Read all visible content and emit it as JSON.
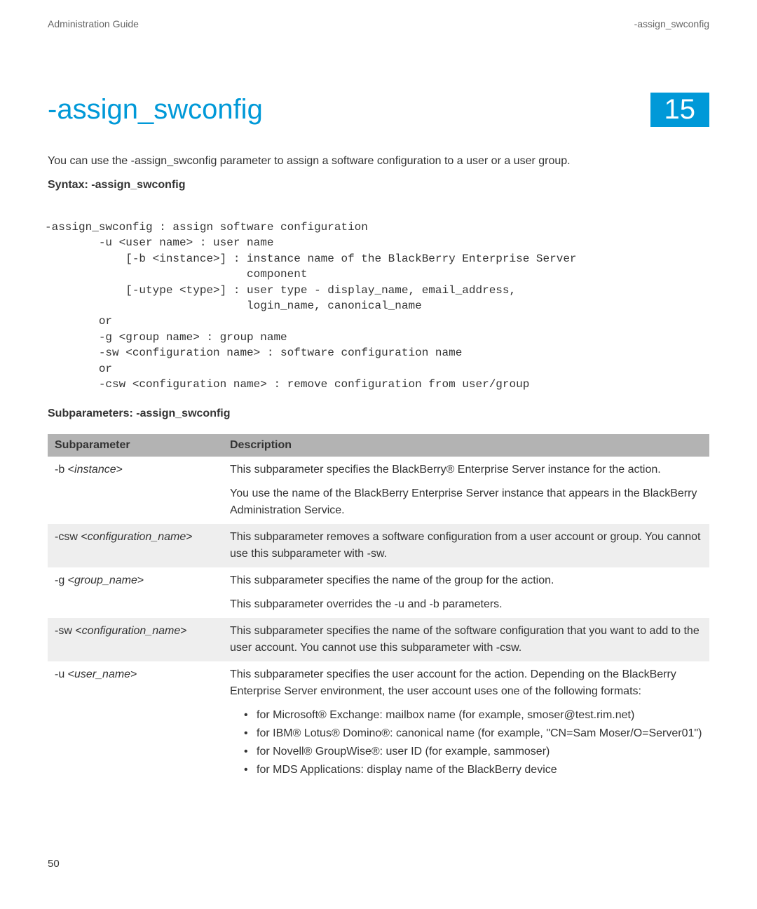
{
  "header": {
    "left": "Administration Guide",
    "right": "-assign_swconfig"
  },
  "title": "-assign_swconfig",
  "chapter": "15",
  "intro": "You can use the -assign_swconfig parameter to assign a software configuration to a user or a user group.",
  "syntax_label_prefix": "Syntax: ",
  "syntax_label_bold": "-assign_swconfig",
  "code": "-assign_swconfig : assign software configuration\n        -u <user name> : user name\n            [-b <instance>] : instance name of the BlackBerry Enterprise Server\n                              component\n            [-utype <type>] : user type - display_name, email_address,\n                              login_name, canonical_name\n        or\n        -g <group name> : group name\n        -sw <configuration name> : software configuration name\n        or\n        -csw <configuration name> : remove configuration from user/group",
  "subparam_label_prefix": "Subparameters: ",
  "subparam_label_bold": "-assign_swconfig",
  "table": {
    "headers": {
      "col1": "Subparameter",
      "col2": "Description"
    },
    "rows": [
      {
        "param_prefix": "-b <",
        "param_italic": "instance",
        "param_suffix": ">",
        "desc_p1": "This subparameter specifies the BlackBerry® Enterprise Server instance for the action.",
        "desc_p2": "You use the name of the BlackBerry Enterprise Server instance that appears in the BlackBerry Administration Service."
      },
      {
        "param_prefix": "-csw <",
        "param_italic": "configuration_name",
        "param_suffix": ">",
        "desc_p1": "This subparameter removes a software configuration from a user account or group. You cannot use this subparameter with -sw."
      },
      {
        "param_prefix": "-g <",
        "param_italic": "group_name",
        "param_suffix": ">",
        "desc_p1": "This subparameter specifies the name of the group for the action.",
        "desc_p2": "This subparameter overrides the -u and -b parameters."
      },
      {
        "param_prefix": "-sw <",
        "param_italic": "configuration_name",
        "param_suffix": ">",
        "desc_p1": "This subparameter specifies the name of the software configuration that you want to add to the user account. You cannot use this subparameter with -csw."
      },
      {
        "param_prefix": "-u <",
        "param_italic": "user_name",
        "param_suffix": ">",
        "desc_p1": "This subparameter specifies the user account for the action. Depending on the BlackBerry Enterprise Server environment, the user account uses one of the following formats:",
        "bullets": [
          "for Microsoft® Exchange: mailbox name (for example, smoser@test.rim.net)",
          "for IBM® Lotus® Domino®: canonical name (for example, \"CN=Sam Moser/O=Server01\")",
          "for Novell® GroupWise®: user ID (for example, sammoser)",
          "for MDS Applications: display name of the BlackBerry device"
        ]
      }
    ]
  },
  "page_number": "50"
}
